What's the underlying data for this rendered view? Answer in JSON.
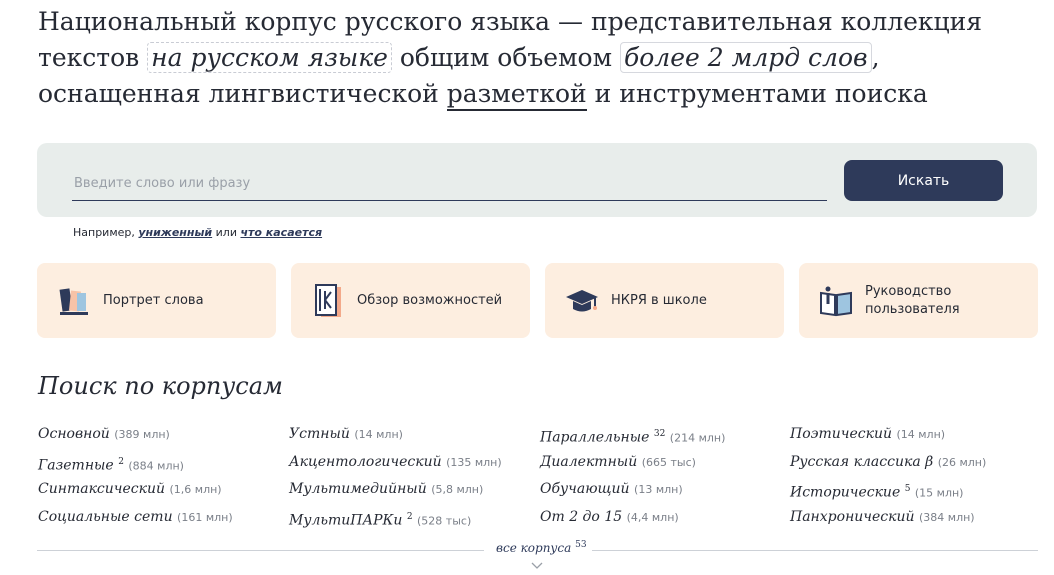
{
  "hero": {
    "p1": "Национальный корпус русского языка — представительная коллекция текстов ",
    "h1": "на русском языке",
    "p2": " общим объемом ",
    "h2": "более 2 млрд слов",
    "p3": ", оснащенная лингвистической ",
    "h3": "разметкой",
    "p4": " и инструментами поиска"
  },
  "search": {
    "placeholder": "Введите слово или фразу",
    "button_label": "Искать"
  },
  "example": {
    "prefix": "Например, ",
    "link1": "униженный",
    "middle": " или ",
    "link2": "что касается"
  },
  "cards": [
    {
      "label": "Портрет слова",
      "icon": "word-portrait-icon"
    },
    {
      "label": "Обзор возможностей",
      "icon": "book-overview-icon"
    },
    {
      "label": "НКРЯ в школе",
      "icon": "graduation-cap-icon"
    },
    {
      "label": "Руководство пользователя",
      "icon": "open-book-icon"
    }
  ],
  "corpora_title": "Поиск по корпусам",
  "corpora": [
    [
      {
        "name": "Основной",
        "sup": "",
        "count": "(389 млн)"
      },
      {
        "name": "Газетные",
        "sup": "2",
        "count": "(884 млн)"
      },
      {
        "name": "Синтаксический",
        "sup": "",
        "count": "(1,6 млн)"
      },
      {
        "name": "Социальные сети",
        "sup": "",
        "count": "(161 млн)"
      }
    ],
    [
      {
        "name": "Устный",
        "sup": "",
        "count": "(14 млн)"
      },
      {
        "name": "Акцентологический",
        "sup": "",
        "count": "(135 млн)"
      },
      {
        "name": "Мультимедийный",
        "sup": "",
        "count": "(5,8 млн)"
      },
      {
        "name": "МультиПАРКи",
        "sup": "2",
        "count": "(528 тыс)"
      }
    ],
    [
      {
        "name": "Параллельные",
        "sup": "32",
        "count": "(214 млн)"
      },
      {
        "name": "Диалектный",
        "sup": "",
        "count": "(665 тыс)"
      },
      {
        "name": "Обучающий",
        "sup": "",
        "count": "(13 млн)"
      },
      {
        "name": "От 2 до 15",
        "sup": "",
        "count": "(4,4 млн)"
      }
    ],
    [
      {
        "name": "Поэтический",
        "sup": "",
        "count": "(14 млн)"
      },
      {
        "name": "Русская классика β",
        "sup": "",
        "count": "(26 млн)"
      },
      {
        "name": "Исторические",
        "sup": "5",
        "count": "(15 млн)"
      },
      {
        "name": "Панхронический",
        "sup": "",
        "count": "(384 млн)"
      }
    ]
  ],
  "all_corpora": {
    "label": "все корпуса",
    "sup": "53"
  },
  "colors": {
    "accent": "#2e3a5a",
    "card_bg": "#fdeee0",
    "panel_bg": "#e8edeb"
  }
}
